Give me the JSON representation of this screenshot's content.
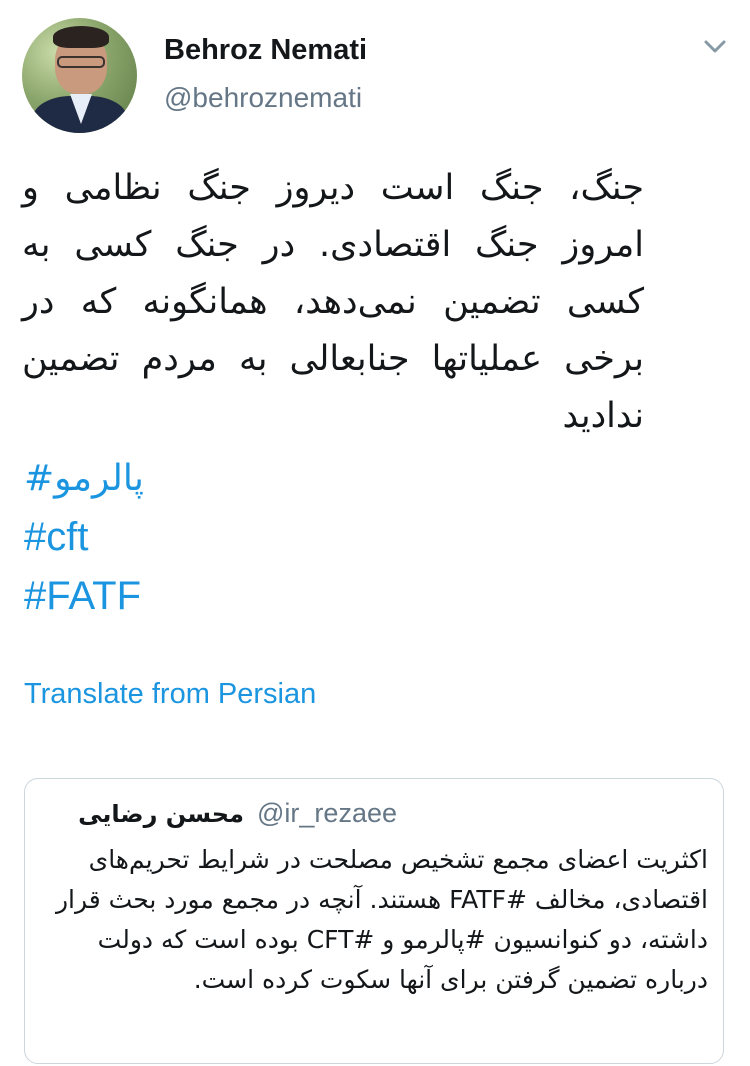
{
  "author": {
    "name": "Behroz Nemati",
    "handle": "@behroznemati"
  },
  "tweet": {
    "text": "جنگ، جنگ است دیروز جنگ نظامی و امروز جنگ اقتصادی. در جنگ کسی به کسی تضمین نمی‌دهد، همانگونه که در برخی عملیاتها جنابعالی به مردم تضمین ندادید",
    "hashtags": [
      "#پالرمو",
      "#cft",
      "#FATF"
    ],
    "translate_label": "Translate from Persian"
  },
  "quoted_tweet": {
    "author_name": "محسن رضایی",
    "author_handle": "@ir_rezaee",
    "text": "اکثریت اعضای مجمع تشخیص مصلحت در شرایط تحریم‌های اقتصادی، مخالف #FATF هستند. آنچه در مجمع مورد بحث قرار داشته، دو کنوانسیون #پالرمو و #CFT بوده است که دولت درباره تضمین گرفتن برای آنها سکوت کرده است."
  },
  "icons": {
    "menu": "chevron-down-icon",
    "avatar": "user-avatar"
  },
  "colors": {
    "link": "#1b95e0",
    "secondary_text": "#657786",
    "border": "#ccd6dd"
  }
}
